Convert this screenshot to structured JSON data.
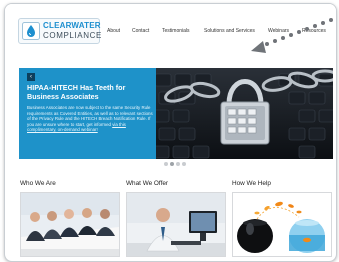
{
  "brand": {
    "line1": "CLEARWATER",
    "line2": "COMPLIANCE",
    "color": "#1d8fcf"
  },
  "nav": {
    "about": "About",
    "contact": "Contact",
    "testimonials": "Testimonials",
    "solutions": "Solutions and Services",
    "webinars": "Webinars",
    "resources": "Resources"
  },
  "hero": {
    "prev_icon": "‹",
    "title": "HIPAA-HITECH Has Teeth for Business Associates",
    "body": "Business Associates are now subject to the same Security Rule requirements as Covered Entities, as well as to relevant sections of the Privacy Rule and the HITECH Breach Notification Rule. If you are unsure where to start, get informed",
    "link": "via this complimentary, on-demand webinar!",
    "accent_color": "#1e92c9",
    "image": "padlock-on-keyboard"
  },
  "carousel": {
    "slides": 4,
    "active": 1
  },
  "sections": {
    "who": {
      "title": "Who We Are",
      "image": "business-meeting"
    },
    "what": {
      "title": "What We Offer",
      "image": "man-at-computer"
    },
    "how": {
      "title": "How We Help",
      "image": "goldfish-jumping-bowls"
    }
  },
  "annotation": {
    "icon": "dotted-arrow-icon"
  }
}
